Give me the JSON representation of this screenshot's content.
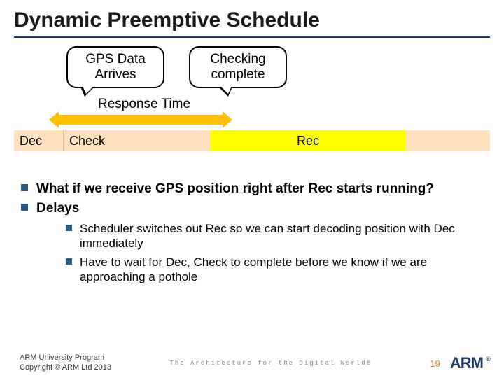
{
  "title": "Dynamic Preemptive Schedule",
  "speech": {
    "gps": "GPS Data Arrives",
    "check": "Checking complete"
  },
  "response_label": "Response Time",
  "timeline": {
    "dec": "Dec",
    "check": "Check",
    "rec": "Rec"
  },
  "bullets": {
    "b1": "What if we receive GPS position right after Rec starts running?",
    "b2": "Delays",
    "sub1": "Scheduler switches out Rec so we can start decoding position with Dec immediately",
    "sub2": "Have to wait for Dec, Check to complete before we know if we are approaching a pothole"
  },
  "footer": {
    "line1": "ARM University Program",
    "line2": "Copyright © ARM Ltd 2013",
    "tagline": "The Architecture for the Digital World®",
    "page": "19",
    "logo": "ARM"
  }
}
